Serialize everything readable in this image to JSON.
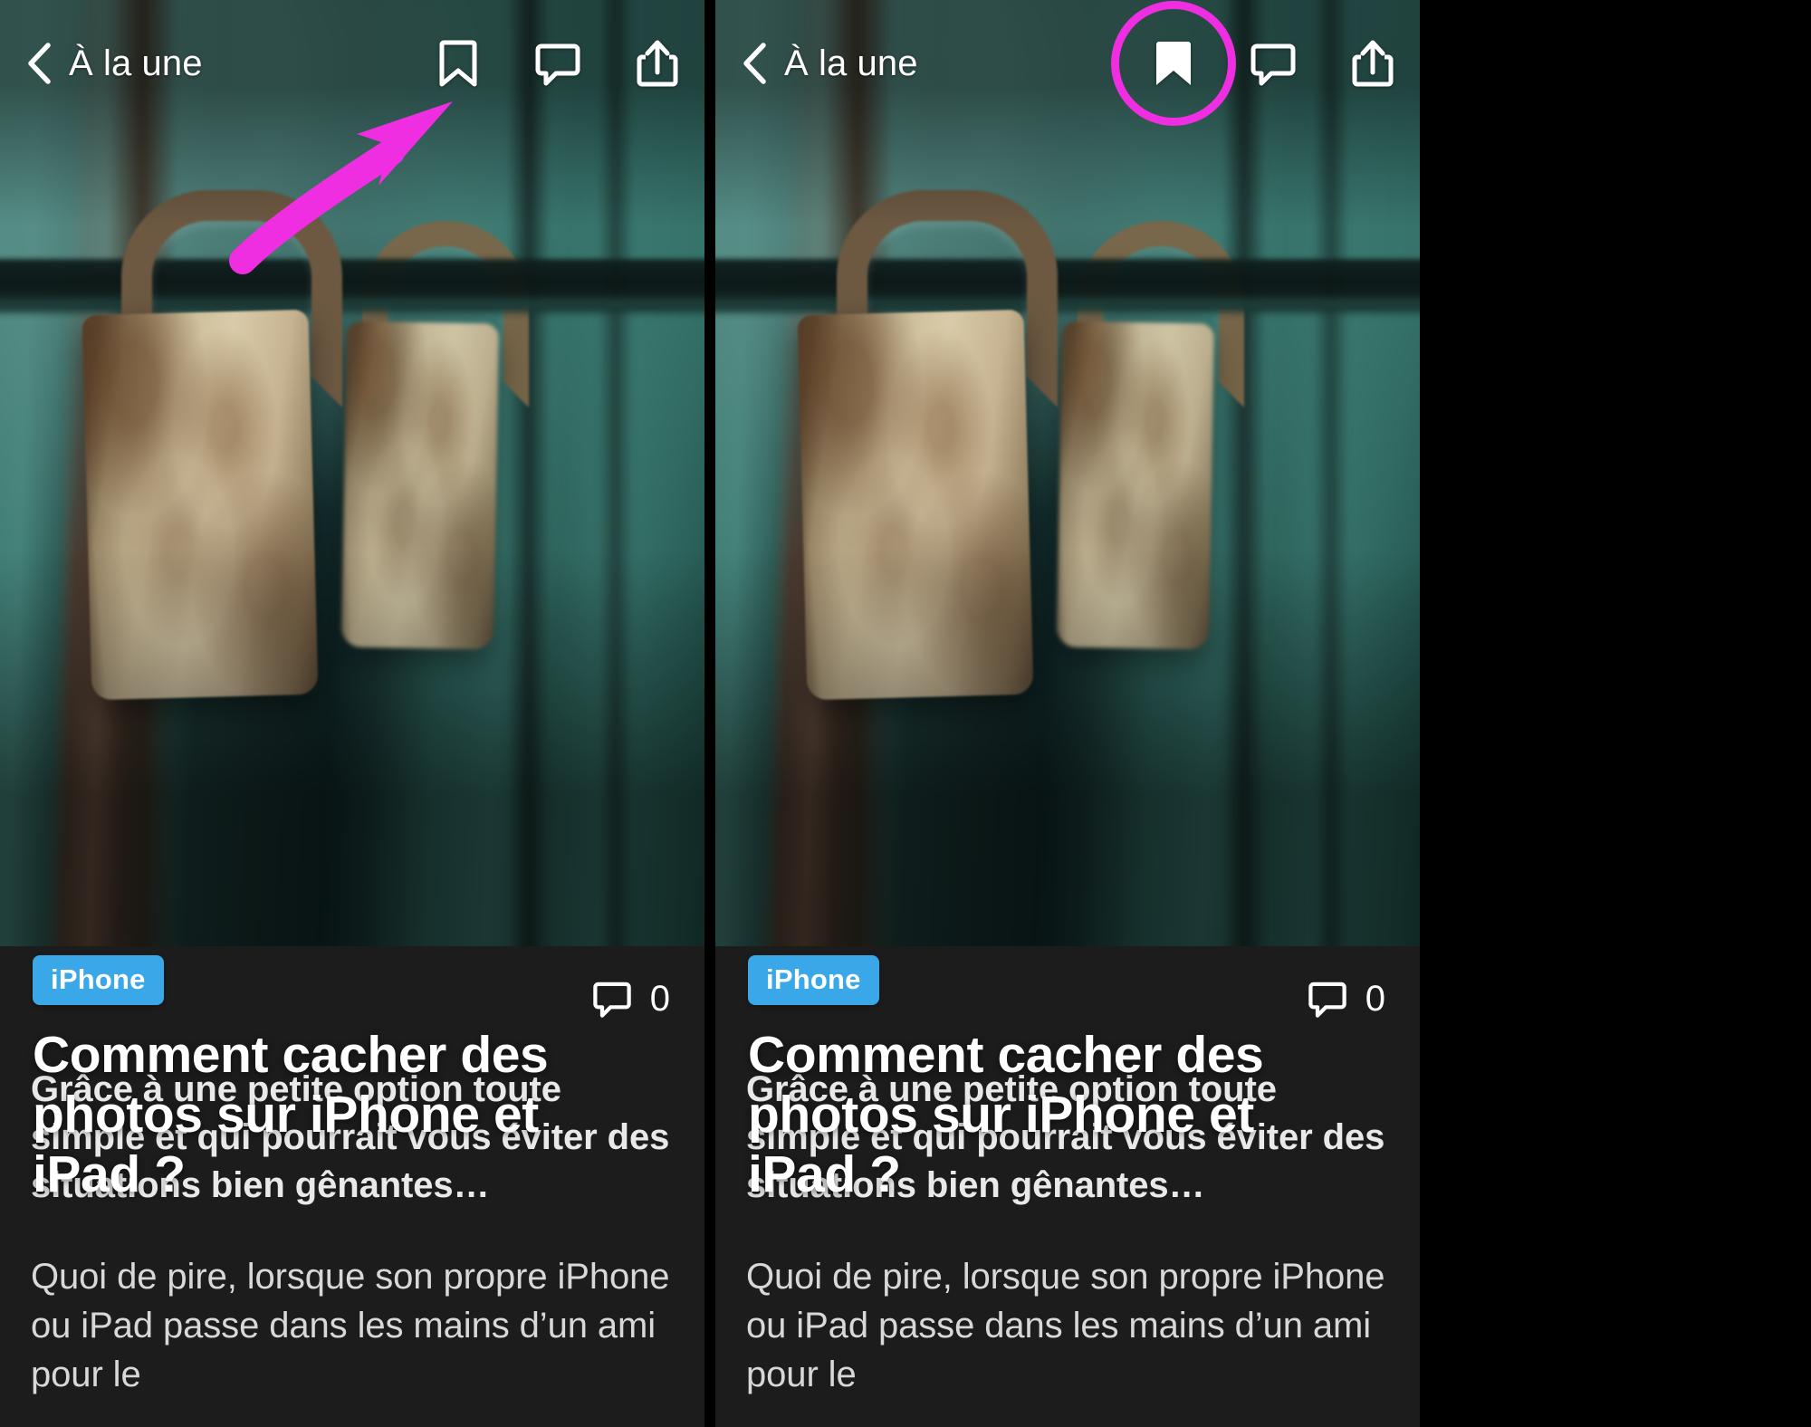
{
  "app": {
    "nav": {
      "back_label": "À la une",
      "back_icon": "chevron-left-icon",
      "actions": [
        {
          "name": "bookmark-icon",
          "label": "Bookmark"
        },
        {
          "name": "comment-icon",
          "label": "Comments"
        },
        {
          "name": "share-icon",
          "label": "Share"
        }
      ]
    },
    "article": {
      "category": "iPhone",
      "title": "Comment cacher des photos sur iPhone et iPad ?",
      "comment_count": "0",
      "comment_icon": "comment-icon",
      "lead": "Grâce à une petite option toute simple et qui pourrait vous éviter des situations bien gênantes…",
      "paragraph": "Quoi de pire, lorsque son propre iPhone ou iPad passe dans les mains d’un ami pour le"
    }
  },
  "panels": [
    {
      "id": "before",
      "bookmark_state": "outline",
      "annotation": {
        "type": "arrow",
        "color": "#ee2ee0",
        "points_to": "bookmark-icon"
      }
    },
    {
      "id": "after",
      "bookmark_state": "filled",
      "annotation": {
        "type": "circle",
        "color": "#ee2ee0",
        "around": "bookmark-icon"
      }
    }
  ],
  "colors": {
    "accent_highlight": "#ee2ee0",
    "badge_blue": "#3aa8e8",
    "body_background": "#1c1c1c",
    "text_primary": "#ffffff"
  }
}
